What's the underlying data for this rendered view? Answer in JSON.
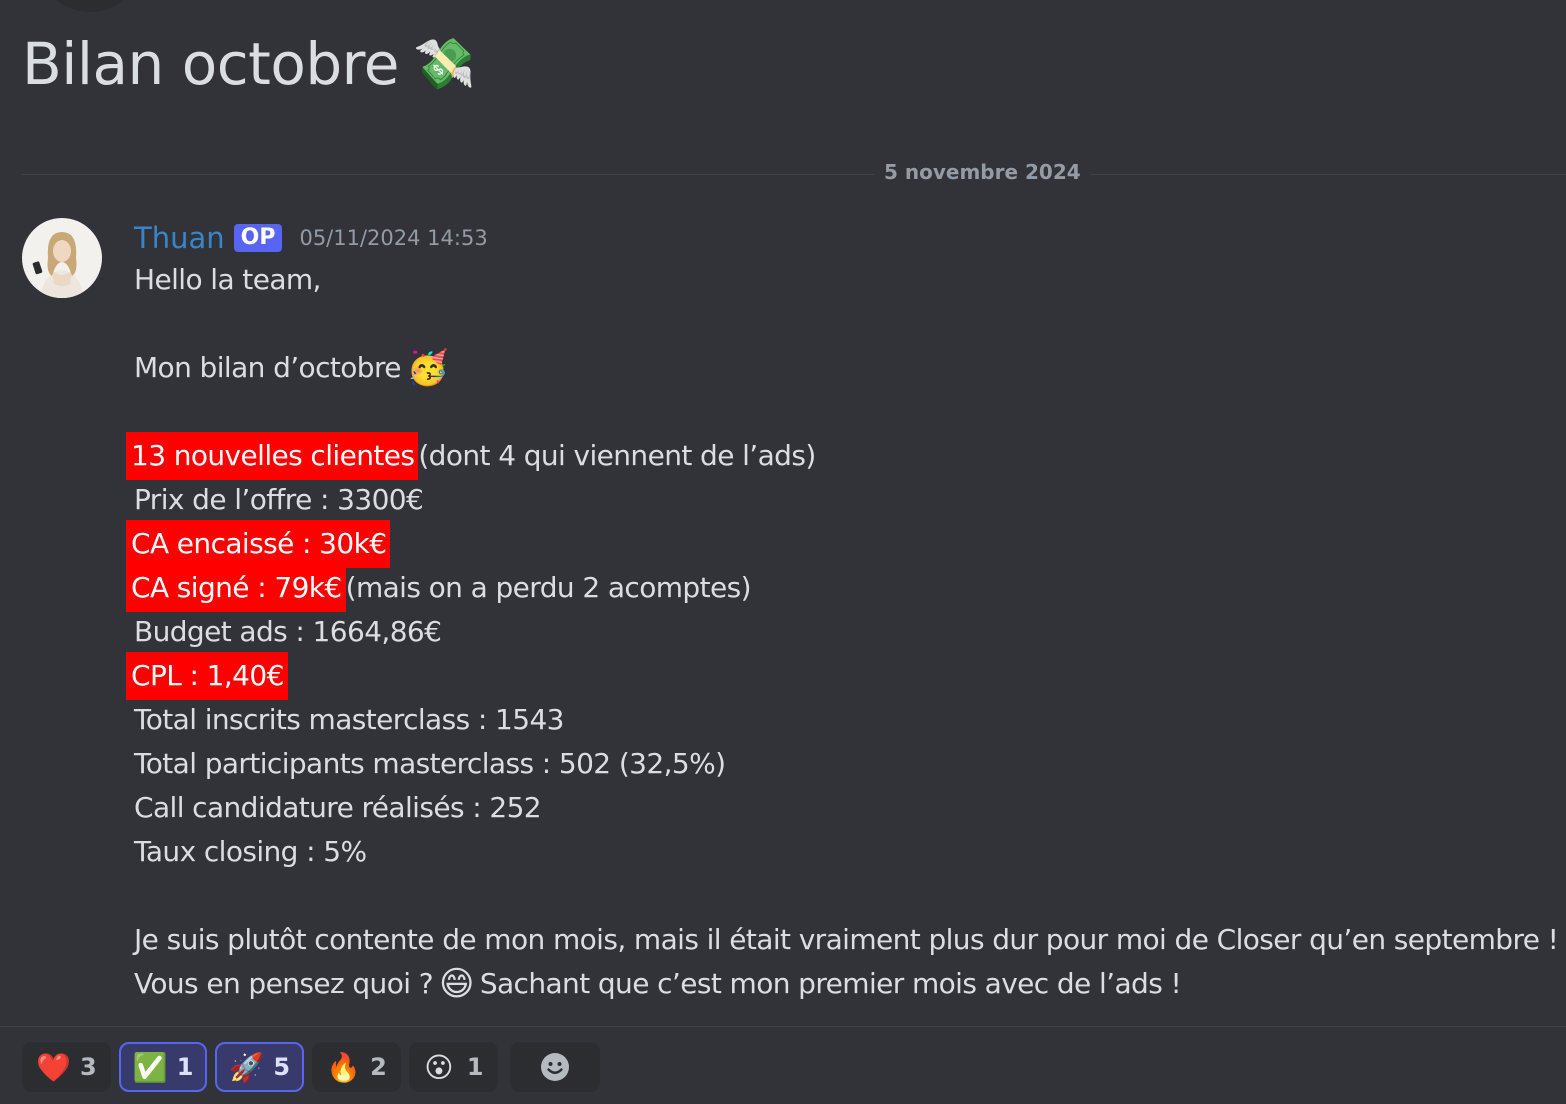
{
  "thread": {
    "title": "Bilan octobre",
    "title_emoji": "💸"
  },
  "date_divider": "5 novembre 2024",
  "message": {
    "author": "Thuan",
    "badge": "OP",
    "timestamp": "05/11/2024 14:53",
    "greeting": "Hello la team,",
    "intro": "Mon bilan d’octobre",
    "intro_emoji": "🥳",
    "stats": [
      {
        "highlight": "13 nouvelles clientes",
        "text": " (dont 4 qui viennent de l’ads)"
      },
      {
        "highlight": "",
        "text": "Prix de l’offre : 3300€"
      },
      {
        "highlight": "CA encaissé : 30k€",
        "text": ""
      },
      {
        "highlight": "CA signé : 79k€",
        "text": " (mais on a perdu 2 acomptes)"
      },
      {
        "highlight": "",
        "text": "Budget ads : 1664,86€"
      },
      {
        "highlight": "CPL : 1,40€",
        "text": ""
      },
      {
        "highlight": "",
        "text": "Total inscrits masterclass : 1543"
      },
      {
        "highlight": "",
        "text": "Total participants masterclass : 502 (32,5%)"
      },
      {
        "highlight": "",
        "text": "Call candidature réalisés : 252"
      },
      {
        "highlight": "",
        "text": "Taux closing : 5%"
      }
    ],
    "closing_line1": "Je suis plutôt contente de mon mois, mais il était vraiment plus dur pour moi de Closer qu’en septembre !",
    "closing_line2_a": "Vous en pensez quoi ?",
    "closing_emoji": "😄",
    "closing_line2_b": "Sachant que c’est mon premier mois avec de l’ads !"
  },
  "reactions": [
    {
      "emoji": "❤️",
      "name": "heart",
      "count": "3",
      "me": false
    },
    {
      "emoji": "✅",
      "name": "check",
      "count": "1",
      "me": true
    },
    {
      "emoji": "🚀",
      "name": "rocket",
      "count": "5",
      "me": true
    },
    {
      "emoji": "🔥",
      "name": "fire",
      "count": "2",
      "me": false
    },
    {
      "emoji": "😮",
      "name": "astonished",
      "count": "1",
      "me": false
    }
  ],
  "add_reaction_icon": "smiley-face-icon",
  "colors": {
    "background": "#313338",
    "text": "#dbdee1",
    "username": "#3a85c8",
    "badge": "#5865f2",
    "highlight": "#ff0000"
  }
}
